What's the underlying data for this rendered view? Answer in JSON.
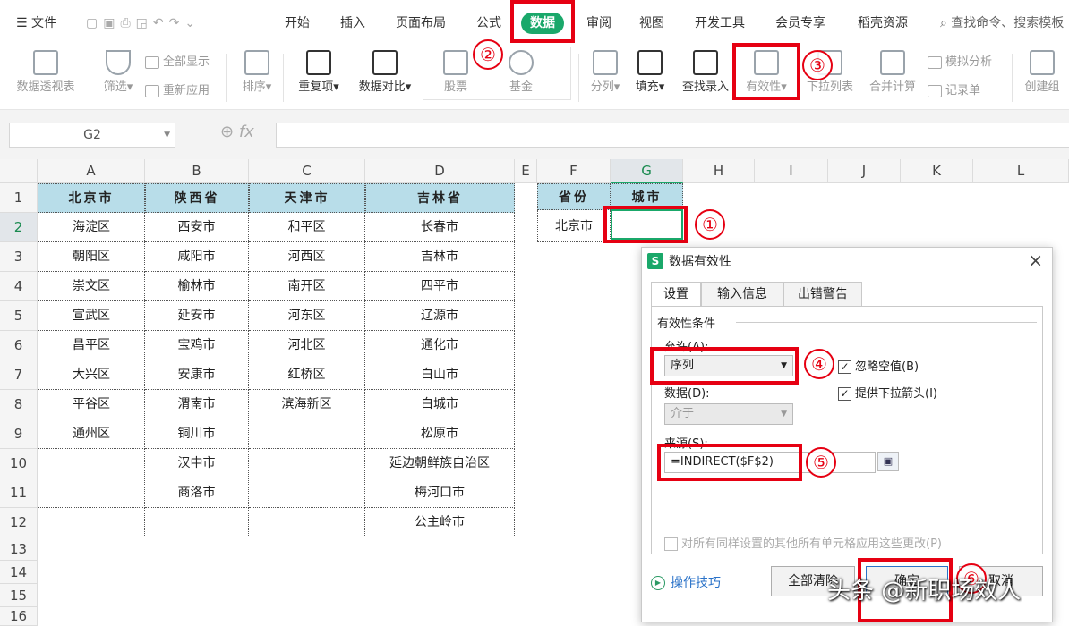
{
  "menubar": {
    "file_label": "文件",
    "tabs": [
      "开始",
      "插入",
      "页面布局",
      "公式",
      "数据",
      "审阅",
      "视图",
      "开发工具",
      "会员专享",
      "稻壳资源"
    ],
    "active_tab": "数据",
    "search_placeholder": "查找命令、搜索模板"
  },
  "ribbon": {
    "pivot": "数据透视表",
    "filter": "筛选",
    "show_all": "全部显示",
    "reapply": "重新应用",
    "sort": "排序",
    "duplicates": "重复项",
    "compare": "数据对比",
    "stock": "股票",
    "fund": "基金",
    "split": "分列",
    "fill": "填充",
    "lookup": "查找录入",
    "validity": "有效性",
    "dropdown": "下拉列表",
    "consolidate": "合并计算",
    "simulate": "模拟分析",
    "record": "记录单",
    "create_group": "创建组"
  },
  "formula_bar": {
    "name_box": "G2",
    "fx": "fx",
    "formula": ""
  },
  "columns": [
    "A",
    "B",
    "C",
    "D",
    "E",
    "F",
    "G",
    "H",
    "I",
    "J",
    "K",
    "L"
  ],
  "rows": [
    "1",
    "2",
    "3",
    "4",
    "5",
    "6",
    "7",
    "8",
    "9",
    "10",
    "11",
    "12",
    "13",
    "14",
    "15",
    "16"
  ],
  "table": {
    "headers": [
      "北京市",
      "陕西省",
      "天津市",
      "吉林省"
    ],
    "rows": [
      [
        "海淀区",
        "西安市",
        "和平区",
        "长春市"
      ],
      [
        "朝阳区",
        "咸阳市",
        "河西区",
        "吉林市"
      ],
      [
        "崇文区",
        "榆林市",
        "南开区",
        "四平市"
      ],
      [
        "宣武区",
        "延安市",
        "河东区",
        "辽源市"
      ],
      [
        "昌平区",
        "宝鸡市",
        "河北区",
        "通化市"
      ],
      [
        "大兴区",
        "安康市",
        "红桥区",
        "白山市"
      ],
      [
        "平谷区",
        "渭南市",
        "滨海新区",
        "白城市"
      ],
      [
        "通州区",
        "铜川市",
        "",
        "松原市"
      ],
      [
        "",
        "汉中市",
        "",
        "延边朝鲜族自治区"
      ],
      [
        "",
        "商洛市",
        "",
        "梅河口市"
      ],
      [
        "",
        "",
        "",
        "公主岭市"
      ]
    ]
  },
  "lookup_table": {
    "header_province": "省份",
    "header_city": "城市",
    "province_value": "北京市",
    "city_value": ""
  },
  "dialog": {
    "title": "数据有效性",
    "logo": "S",
    "close": "×",
    "tabs": [
      "设置",
      "输入信息",
      "出错警告"
    ],
    "group_label": "有效性条件",
    "allow_label": "允许(A):",
    "allow_value": "序列",
    "data_label": "数据(D):",
    "data_value": "介于",
    "source_label": "来源(S):",
    "source_value": "=INDIRECT($F$2)",
    "ignore_blank": "忽略空值(B)",
    "dropdown_arrow": "提供下拉箭头(I)",
    "apply_all": "对所有同样设置的其他所有单元格应用这些更改(P)",
    "tips": "操作技巧",
    "clear_all": "全部清除",
    "ok": "确定",
    "cancel": "取消"
  },
  "annotations": [
    "①",
    "②",
    "③",
    "④",
    "⑤",
    "⑥"
  ],
  "watermark": "头条 @新职场效人",
  "colors": {
    "accent": "#1aa86a",
    "highlight": "#e60012",
    "header_fill": "#b8dde9"
  }
}
